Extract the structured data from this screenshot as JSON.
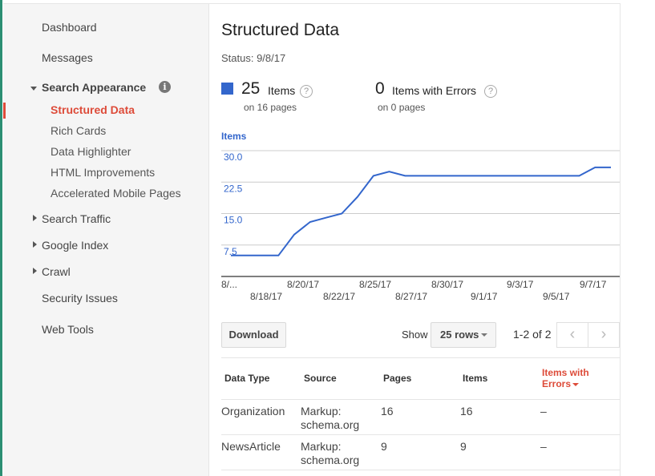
{
  "sidebar": {
    "dashboard": "Dashboard",
    "messages": "Messages",
    "search_appearance": "Search Appearance",
    "search_appearance_items": [
      "Structured Data",
      "Rich Cards",
      "Data Highlighter",
      "HTML Improvements",
      "Accelerated Mobile Pages"
    ],
    "search_traffic": "Search Traffic",
    "google_index": "Google Index",
    "crawl": "Crawl",
    "security_issues": "Security Issues",
    "web_tools": "Web Tools",
    "info_icon": "i"
  },
  "page": {
    "title": "Structured Data",
    "status": "Status: 9/8/17"
  },
  "summary": {
    "items_count": "25",
    "items_label": "Items",
    "items_sub": "on 16 pages",
    "errors_count": "0",
    "errors_label": "Items with Errors",
    "errors_sub": "on 0 pages",
    "help_glyph": "?"
  },
  "chart_data": {
    "type": "line",
    "title": "Items",
    "x_ticks_top": [
      "8/...",
      "8/20/17",
      "8/25/17",
      "8/30/17",
      "9/3/17",
      "9/7/17"
    ],
    "x_ticks_bottom": [
      "8/18/17",
      "8/22/17",
      "8/27/17",
      "9/1/17",
      "9/5/17"
    ],
    "y_ticks": [
      "7.5",
      "15.0",
      "22.5",
      "30.0"
    ],
    "ylim": [
      0,
      30
    ],
    "grid": true,
    "series": [
      {
        "color": "#3366cc",
        "x": [
          "8/15/17",
          "8/16/17",
          "8/17/17",
          "8/18/17",
          "8/19/17",
          "8/20/17",
          "8/21/17",
          "8/22/17",
          "8/23/17",
          "8/24/17",
          "8/25/17",
          "8/26/17",
          "8/27/17",
          "8/28/17",
          "8/29/17",
          "8/30/17",
          "8/31/17",
          "9/1/17",
          "9/2/17",
          "9/3/17",
          "9/4/17",
          "9/5/17",
          "9/6/17",
          "9/7/17",
          "9/8/17"
        ],
        "values": [
          5,
          5,
          5,
          5,
          10,
          13,
          14,
          15,
          19,
          24,
          25,
          24,
          24,
          24,
          24,
          24,
          24,
          24,
          24,
          24,
          24,
          24,
          24,
          26,
          26
        ]
      }
    ]
  },
  "controls": {
    "download": "Download",
    "show_label": "Show",
    "rows_option": "25 rows",
    "pager_text": "1-2 of 2",
    "prev_glyph": "‹",
    "next_glyph": "›"
  },
  "table": {
    "headers": [
      "Data Type",
      "Source",
      "Pages",
      "Items",
      "Items with Errors"
    ],
    "rows": [
      [
        "Organization",
        "Markup:\nschema.org",
        "16",
        "16",
        "–"
      ],
      [
        "NewsArticle",
        "Markup:\nschema.org",
        "9",
        "9",
        "–"
      ]
    ]
  }
}
